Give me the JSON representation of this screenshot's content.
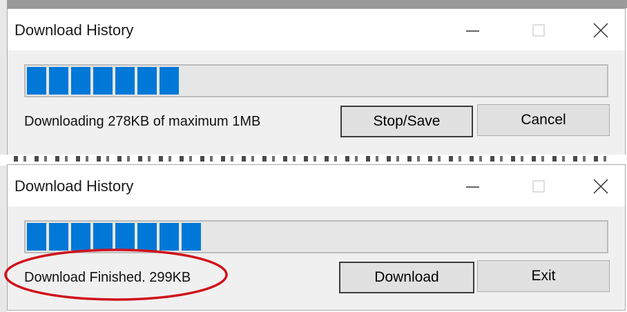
{
  "window_top": {
    "title": "Download History",
    "progress_percent": 27,
    "status": "Downloading 278KB of maximum 1MB",
    "stop_save_label": "Stop/Save",
    "cancel_label": "Cancel"
  },
  "window_bottom": {
    "title": "Download History",
    "progress_percent": 29,
    "status": "Download Finished. 299KB",
    "download_label": "Download",
    "exit_label": "Exit"
  },
  "colors": {
    "progress": "#0078d7",
    "highlight_ellipse": "#d0121b"
  }
}
